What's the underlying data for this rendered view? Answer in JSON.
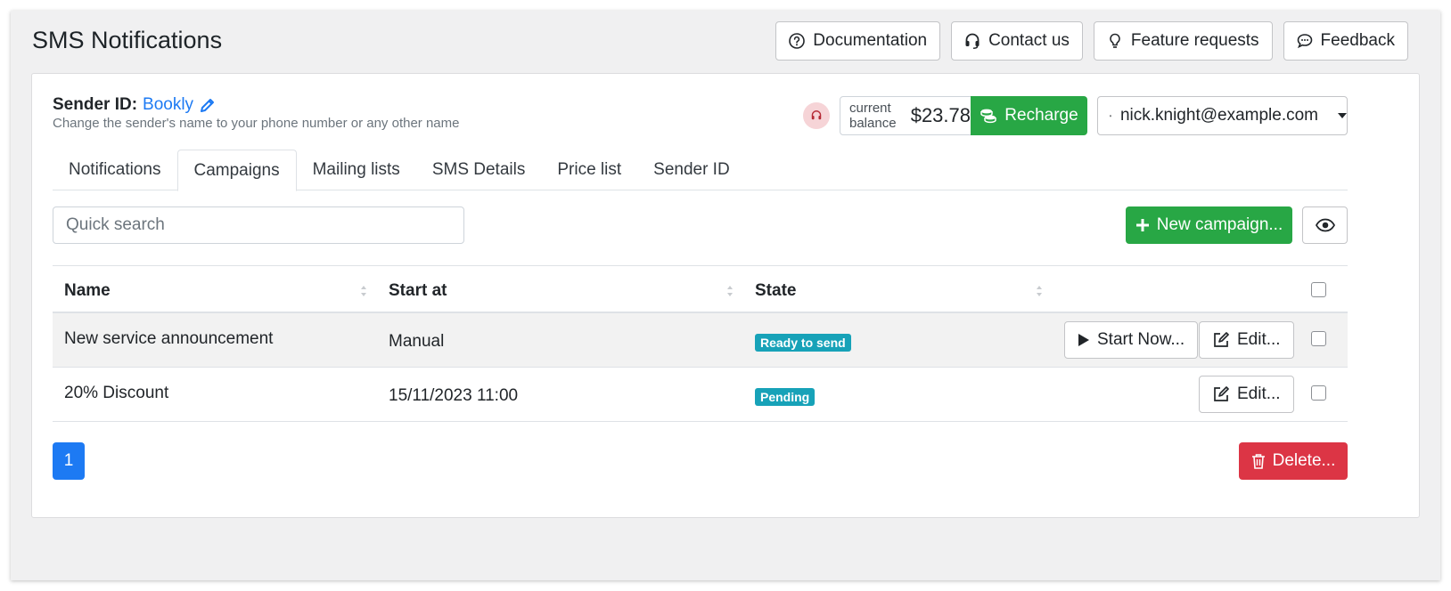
{
  "page": {
    "title": "SMS Notifications"
  },
  "top_buttons": {
    "documentation": "Documentation",
    "contact": "Contact us",
    "feature": "Feature requests",
    "feedback": "Feedback"
  },
  "sender": {
    "label": "Sender ID:",
    "name": "Bookly",
    "help": "Change the sender's name to your phone number or any other name"
  },
  "balance": {
    "label_line1": "current",
    "label_line2": "balance",
    "value": "$23.78",
    "recharge_label": "Recharge"
  },
  "user": {
    "email": "nick.knight@example.com"
  },
  "tabs": [
    {
      "label": "Notifications",
      "active": false
    },
    {
      "label": "Campaigns",
      "active": true
    },
    {
      "label": "Mailing lists",
      "active": false
    },
    {
      "label": "SMS Details",
      "active": false
    },
    {
      "label": "Price list",
      "active": false
    },
    {
      "label": "Sender ID",
      "active": false
    }
  ],
  "search": {
    "placeholder": "Quick search"
  },
  "new_campaign": {
    "label": "New campaign..."
  },
  "table": {
    "headers": {
      "name": "Name",
      "start": "Start at",
      "state": "State"
    },
    "rows": [
      {
        "name": "New service announcement",
        "start": "Manual",
        "state": "Ready to send",
        "start_now": "Start Now...",
        "edit": "Edit..."
      },
      {
        "name": "20% Discount",
        "start": "15/11/2023 11:00",
        "state": "Pending",
        "edit": "Edit..."
      }
    ]
  },
  "pagination": {
    "current": "1"
  },
  "delete": {
    "label": "Delete..."
  },
  "colors": {
    "green": "#28a745",
    "blue": "#1d7af3",
    "red": "#dc3545",
    "badge": "#17a2b8"
  }
}
